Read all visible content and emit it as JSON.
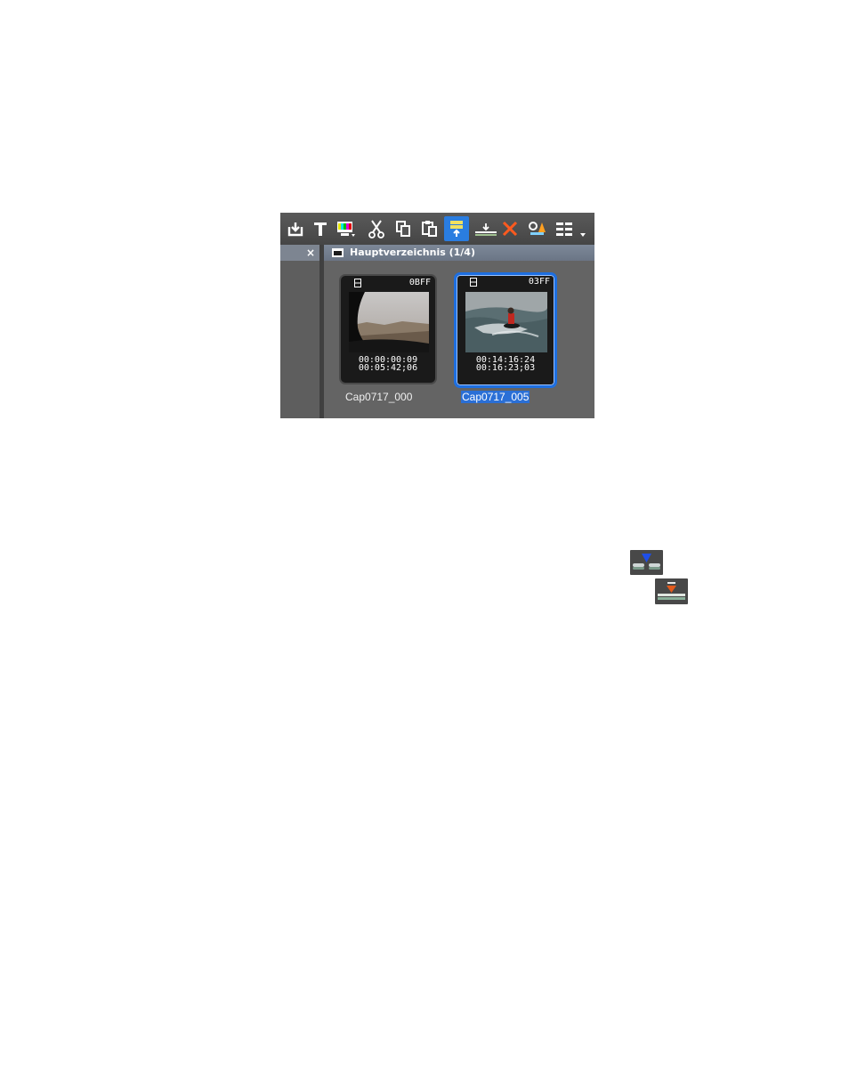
{
  "toolbar": {
    "buttons": [
      {
        "name": "import-button",
        "icon": "import-icon"
      },
      {
        "name": "title-button",
        "icon": "title-text-icon"
      },
      {
        "name": "color-bars-button",
        "icon": "color-bars-icon"
      },
      {
        "name": "cut-button",
        "icon": "scissors-icon"
      },
      {
        "name": "copy-button",
        "icon": "copy-icon"
      },
      {
        "name": "paste-button",
        "icon": "paste-icon"
      },
      {
        "name": "load-to-player-button",
        "icon": "load-player-icon",
        "active": true
      },
      {
        "name": "add-to-timeline-button",
        "icon": "add-timeline-icon"
      },
      {
        "name": "delete-button",
        "icon": "delete-x-icon"
      },
      {
        "name": "properties-button",
        "icon": "properties-icon"
      },
      {
        "name": "view-mode-button",
        "icon": "view-grid-icon"
      }
    ]
  },
  "left_pane": {
    "close_label": "×"
  },
  "folder": {
    "title": "Hauptverzeichnis (1/4)"
  },
  "clips": [
    {
      "code": "0BFF",
      "timecode_in": "00:00:00:09",
      "timecode_out": "00:05:42;06",
      "label": "Cap0717_000",
      "selected": false
    },
    {
      "code": "03FF",
      "timecode_in": "00:14:16:24",
      "timecode_out": "00:16:23;03",
      "label": "Cap0717_005",
      "selected": true
    }
  ],
  "inline_icons": [
    {
      "name": "insert-marker-icon",
      "color": "#1f4fe8"
    },
    {
      "name": "overwrite-marker-icon",
      "color": "#e25a1c"
    }
  ],
  "colors": {
    "selection": "#1e6fe0",
    "panel": "#646464",
    "header": "#7d8898"
  }
}
